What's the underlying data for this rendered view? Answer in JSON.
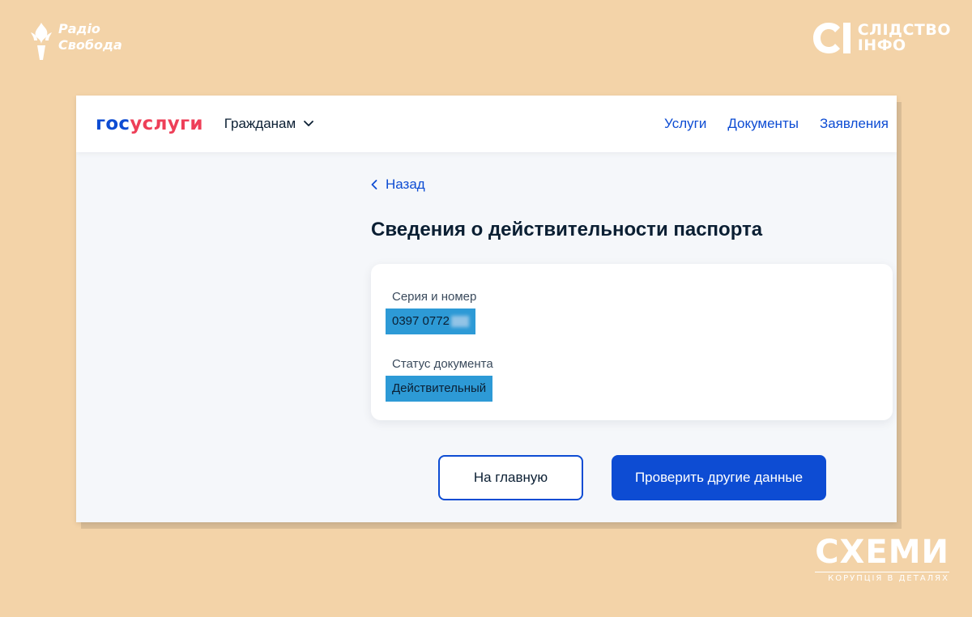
{
  "watermarks": {
    "radio_line1": "Радіо",
    "radio_line2": "Свобода",
    "slidstvo_line1": "СЛІДСТВО",
    "slidstvo_line2": "ІНФО",
    "schemes_title": "СХЕМИ",
    "schemes_subtitle": "КОРУПЦІЯ В ДЕТАЛЯХ"
  },
  "header": {
    "logo_part1": "гос",
    "logo_part2": "услуги",
    "dropdown_label": "Гражданам",
    "nav": [
      "Услуги",
      "Документы",
      "Заявления"
    ]
  },
  "page": {
    "back_label": "Назад",
    "title": "Сведения о действительности паспорта"
  },
  "card": {
    "series_label": "Серия и номер",
    "series_value": "0397 0772",
    "status_label": "Статус документа",
    "status_value": "Действительный"
  },
  "buttons": {
    "home": "На главную",
    "check_other": "Проверить другие данные"
  },
  "colors": {
    "background": "#f3d3a8",
    "brand_blue": "#0d4cd3",
    "brand_red": "#ee3f58",
    "highlight": "#2d9ad6",
    "text_dark": "#0b1f33"
  },
  "icons": {
    "dropdown": "chevron-down-icon",
    "back": "chevron-left-icon"
  }
}
